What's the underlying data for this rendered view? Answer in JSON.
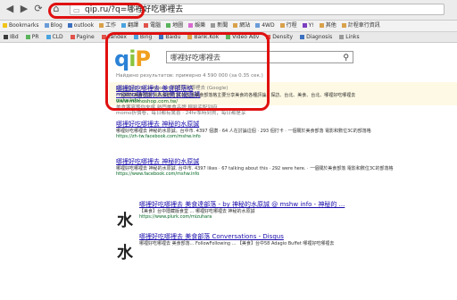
{
  "browser": {
    "url": "qip.ru/?q=哪裡好吃哪裡去",
    "bookmarks": [
      {
        "label": "Bookmarks",
        "color": "#f0c419"
      },
      {
        "label": "Blog",
        "color": "#6a9cd9"
      },
      {
        "label": "outlook",
        "color": "#3b6fc0"
      },
      {
        "label": "工作",
        "color": "#d9a14a"
      },
      {
        "label": "翻譯",
        "color": "#4aa3df"
      },
      {
        "label": "電腦",
        "color": "#e0524a"
      },
      {
        "label": "地圖",
        "color": "#5ab35a"
      },
      {
        "label": "娛樂",
        "color": "#d96ad0"
      },
      {
        "label": "新聞",
        "color": "#999999"
      },
      {
        "label": "網站",
        "color": "#d9a14a"
      },
      {
        "label": "4WD",
        "color": "#6a9cd9"
      },
      {
        "label": "行程",
        "color": "#d9a14a"
      },
      {
        "label": "Y!",
        "color": "#7b3fbf"
      },
      {
        "label": "其他",
        "color": "#d9a14a"
      },
      {
        "label": "計程車行資訊",
        "color": "#d9a14a"
      }
    ],
    "extensions": [
      {
        "label": "IBd",
        "color": "#3a3a3a"
      },
      {
        "label": "PR",
        "color": "#5ab35a"
      },
      {
        "label": "CLD",
        "color": "#4aa3df"
      },
      {
        "label": "Pagine",
        "color": "#e0524a"
      },
      {
        "label": "Yandex",
        "color": "#e0524a"
      },
      {
        "label": "Bing",
        "color": "#4aa3df"
      },
      {
        "label": "Baidu",
        "color": "#3b6fc0"
      },
      {
        "label": "Bank.Kok",
        "color": "#d9a14a"
      },
      {
        "label": "Video Adv",
        "color": "#5ab35a"
      },
      {
        "label": "Density",
        "color": "#e0524a"
      },
      {
        "label": "Diagnosis",
        "color": "#3b6fc0"
      },
      {
        "label": "Links",
        "color": "#999999"
      }
    ]
  },
  "search": {
    "logo": {
      "q": "q",
      "i": "i",
      "p": "P"
    },
    "query": "哪裡好吃哪裡去",
    "result_count": "Найдено результатов: примерно 4 590 000 (за 0.35 сек.)"
  },
  "ad": {
    "label": "Реклама по запросу: 哪裡好吃哪裡去 (Google)",
    "title": "momo購物網 人氣美食優惠購",
    "url": "www.momoshop.com.tw/",
    "extra_line1": "美食饗宴等你來嚐 熱門美食品牌 輕鬆宅配到府",
    "extra_line2": "momo折價卷，每日都有驚喜 · 24hr準時到貨，每日都是享"
  },
  "results": [
    {
      "title": "哪裡好吃哪裡去 美食部落格",
      "snippet": "一個關於美食部落 電影和數位3C的生活美食部落格主要分享美食的各種評論、探訪、台北、美食、台北、哪裡好吃哪裡去",
      "url": "mshw.info/",
      "has_thumb": true
    },
    {
      "title": "哪裡好吃哪裡去 神秘的水原誠",
      "snippet": "哪裡好吃哪裡去 神秘的水原誠。台中市. 4397 個讚 · 64 人在討論這個 · 293 個打卡 · 一個關於美食部落 電影和數位3C的部落格",
      "url": "https://zh-tw.facebook.com/mshw.info",
      "has_thumb": false
    },
    {
      "title": "哪裡好吃哪裡去 神秘的水原誠",
      "snippet": "哪裡好吃哪裡去 神秘的水原誠. 台中市. 4397 likes · 67 talking about this · 292 were here. · 一個關於美食部落 電影和數位3C的部落格",
      "url": "https://www.facebook.com/mshw.info",
      "has_thumb": false
    },
    {
      "title": "哪裡好吃哪裡去 美食達部落 - by 神秘的水原誠 @ mshw info - 神秘的 ...",
      "snippet": "【美食】台中隱藏版食堂 ... 哪裡好吃哪裡去 神秘的水原誠",
      "url": "https://www.plurk.com/mizuhara",
      "has_thumb": true,
      "thumb_char": "水"
    },
    {
      "title": "哪裡好吃哪裡去 美食部落 Conversations - Disqus",
      "snippet": "哪裡好吃哪裡去 美食部落... FollowFollowing ... 【美食】台中58 Adagio Buffet 哪裡好吃哪裡去",
      "url": "",
      "has_thumb": true,
      "thumb_char": "水"
    }
  ],
  "colors": {
    "annotation": "#e01010",
    "link": "#1a0dab",
    "url": "#006621",
    "ad_bg": "#fef9e4"
  }
}
